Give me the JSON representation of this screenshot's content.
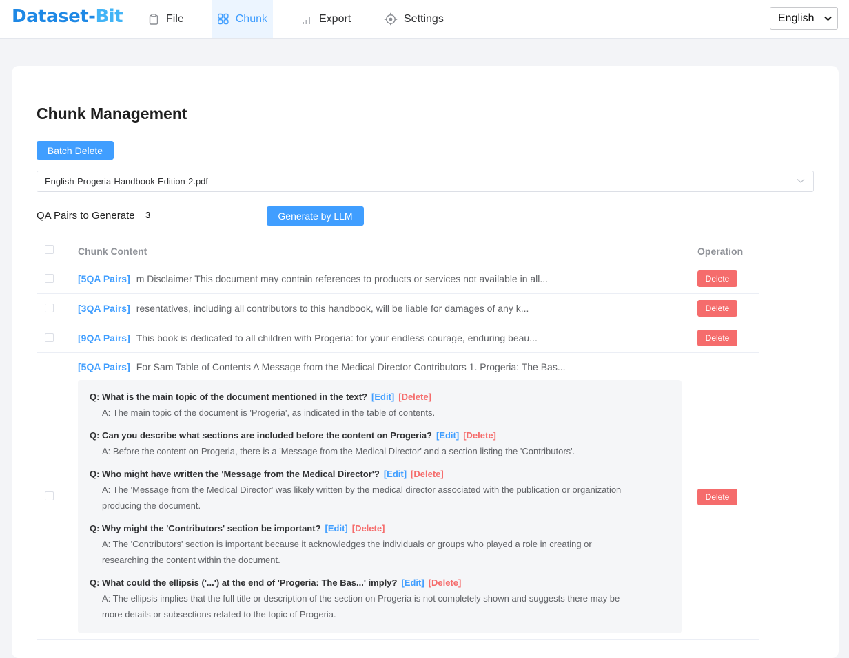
{
  "app": {
    "logo_part1": "Dataset-",
    "logo_part2": "Bit"
  },
  "nav": [
    {
      "label": "File",
      "icon": "clipboard-icon"
    },
    {
      "label": "Chunk",
      "icon": "grid-icon",
      "active": true
    },
    {
      "label": "Export",
      "icon": "bar-chart-icon"
    },
    {
      "label": "Settings",
      "icon": "gear-icon"
    }
  ],
  "language": {
    "selected": "English"
  },
  "page": {
    "title": "Chunk Management",
    "batch_delete_label": "Batch Delete",
    "file_selected": "English-Progeria-Handbook-Edition-2.pdf",
    "qa_label": "QA Pairs to Generate",
    "qa_value": "3",
    "generate_label": "Generate by LLM"
  },
  "table": {
    "col_content": "Chunk Content",
    "col_operation": "Operation",
    "delete_label": "Delete",
    "rows": [
      {
        "tag": "[5QA Pairs]",
        "text": "m Disclaimer This document may contain references to products or services not available in all..."
      },
      {
        "tag": "[3QA Pairs]",
        "text": "resentatives, including all contributors to this handbook, will be liable for damages of any k..."
      },
      {
        "tag": "[9QA Pairs]",
        "text": "This book is dedicated to all children with Progeria: for your endless courage, enduring beau..."
      }
    ],
    "expanded": {
      "tag": "[5QA Pairs]",
      "text": "For Sam Table of Contents A Message from the Medical Director Contributors 1. Progeria: The Bas...",
      "edit_label": "[Edit]",
      "delete_label": "[Delete]",
      "qa": [
        {
          "q": "Q: What is the main topic of the document mentioned in the text?",
          "a1": "A: The main topic of the document is 'Progeria', as indicated in the table of contents.",
          "a2": ""
        },
        {
          "q": "Q: Can you describe what sections are included before the content on Progeria?",
          "a1": "A: Before the content on Progeria, there is a 'Message from the Medical Director' and a section listing the 'Contributors'.",
          "a2": ""
        },
        {
          "q": "Q: Who might have written the 'Message from the Medical Director'?",
          "a1": "A: The 'Message from the Medical Director' was likely written by the medical director associated with the publication or organization",
          "a2": "producing the document."
        },
        {
          "q": "Q: Why might the 'Contributors' section be important?",
          "a1": "A: The 'Contributors' section is important because it acknowledges the individuals or groups who played a role in creating or",
          "a2": "researching the content within the document."
        },
        {
          "q": "Q: What could the ellipsis ('...') at the end of 'Progeria: The Bas...' imply?",
          "a1": "A: The ellipsis implies that the full title or description of the section on Progeria is not completely shown and suggests there may be",
          "a2": "more details or subsections related to the topic of Progeria."
        }
      ]
    }
  },
  "colors": {
    "primary": "#409eff",
    "danger": "#f56c6c",
    "logo": "#1e88e5"
  }
}
